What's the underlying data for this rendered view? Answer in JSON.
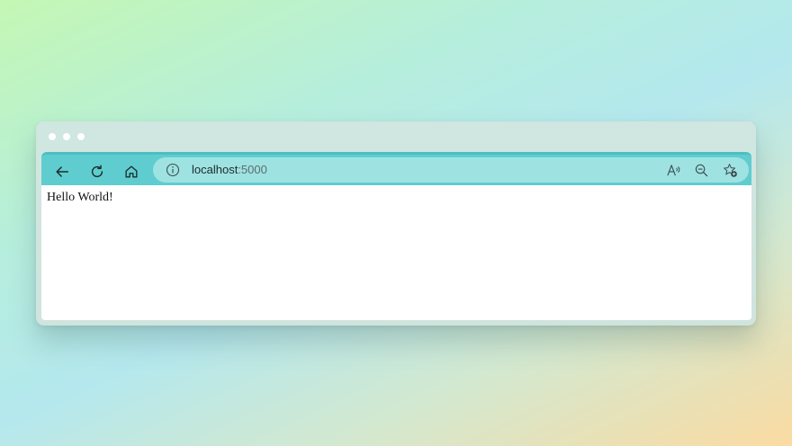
{
  "window": {
    "controls": [
      "dot",
      "dot",
      "dot"
    ]
  },
  "toolbar": {
    "back_icon": "arrow-left-icon",
    "reload_icon": "refresh-icon",
    "home_icon": "home-icon"
  },
  "address_bar": {
    "site_info_icon": "info-icon",
    "host": "localhost",
    "port": ":5000",
    "read_aloud_icon": "read-aloud-icon",
    "zoom_icon": "zoom-out-icon",
    "favorite_icon": "add-favorite-icon"
  },
  "page": {
    "text": "Hello World!"
  },
  "colors": {
    "toolbar": "#5fcdcf",
    "address_bar": "#9fe2e2",
    "frame": "#cfe4dd"
  }
}
